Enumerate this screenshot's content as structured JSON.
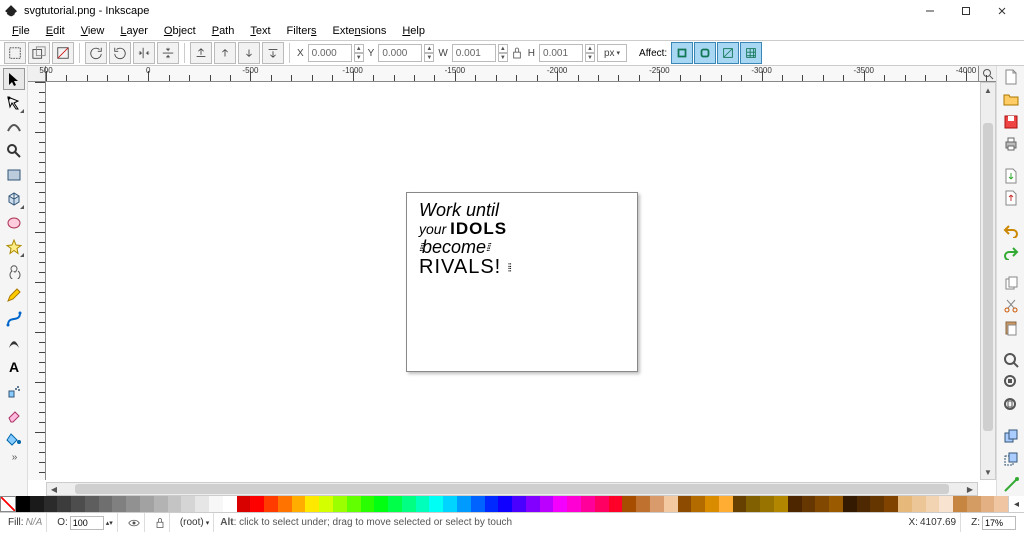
{
  "window": {
    "title": "svgtutorial.png - Inkscape"
  },
  "menu": {
    "file": "File",
    "edit": "Edit",
    "view": "View",
    "layer": "Layer",
    "object": "Object",
    "path": "Path",
    "text": "Text",
    "filters": "Filters",
    "extensions": "Extensions",
    "help": "Help"
  },
  "toolbar": {
    "x_label": "X",
    "x_value": "0.000",
    "y_label": "Y",
    "y_value": "0.000",
    "w_label": "W",
    "w_value": "0.001",
    "h_label": "H",
    "h_value": "0.001",
    "unit": "px",
    "affect_label": "Affect:"
  },
  "ruler": {
    "marks": [
      "500",
      "0",
      "-500",
      "-1000",
      "-1500",
      "-2000",
      "-2500",
      "-3000",
      "-3500",
      "-4000"
    ]
  },
  "artwork": {
    "line1": "Work until",
    "line2a": "your",
    "line2b": "IDOLS",
    "line3": "become",
    "line4": "RIVALS!"
  },
  "palette": {
    "colors": [
      "#000000",
      "#1a1a1a",
      "#2b2b2b",
      "#3c3c3c",
      "#4d4d4d",
      "#5e5e5e",
      "#6f6f6f",
      "#808080",
      "#919191",
      "#a2a2a2",
      "#b3b3b3",
      "#c4c4c4",
      "#d5d5d5",
      "#e6e6e6",
      "#f7f7f7",
      "#ffffff",
      "#d90000",
      "#ff0000",
      "#ff3b00",
      "#ff7400",
      "#ffae00",
      "#ffe800",
      "#d4ff00",
      "#9bff00",
      "#62ff00",
      "#29ff00",
      "#00ff10",
      "#00ff49",
      "#00ff82",
      "#00ffbb",
      "#00fff4",
      "#00d4ff",
      "#009bff",
      "#0062ff",
      "#0029ff",
      "#1000ff",
      "#4900ff",
      "#8200ff",
      "#bb00ff",
      "#f400ff",
      "#ff00d4",
      "#ff009b",
      "#ff0062",
      "#ff0029",
      "#a64d00",
      "#bf7130",
      "#d99a6c",
      "#f2c9a0",
      "#8c4b00",
      "#b36b00",
      "#d98c00",
      "#ffad33",
      "#664000",
      "#806000",
      "#997300",
      "#b38600",
      "#4d2600",
      "#663700",
      "#804800",
      "#995a00",
      "#331a00",
      "#4d2800",
      "#663600",
      "#804400",
      "#e6b87a",
      "#ecc697",
      "#f2d4b3",
      "#f8e2d0",
      "#c68642",
      "#d49b62",
      "#e2b082",
      "#f0c5a2"
    ]
  },
  "status": {
    "fill_label": "Fill:",
    "fill_value": "N/A",
    "opacity_label": "O:",
    "opacity_value": "100",
    "layer_value": "(root)",
    "hint_alt": "Alt",
    "hint_text": ": click to select under; drag to move selected or select by touch",
    "cursor_label": "X:",
    "cursor_value": "4107.69",
    "zoom_label": "Z:",
    "zoom_value": "17%"
  }
}
